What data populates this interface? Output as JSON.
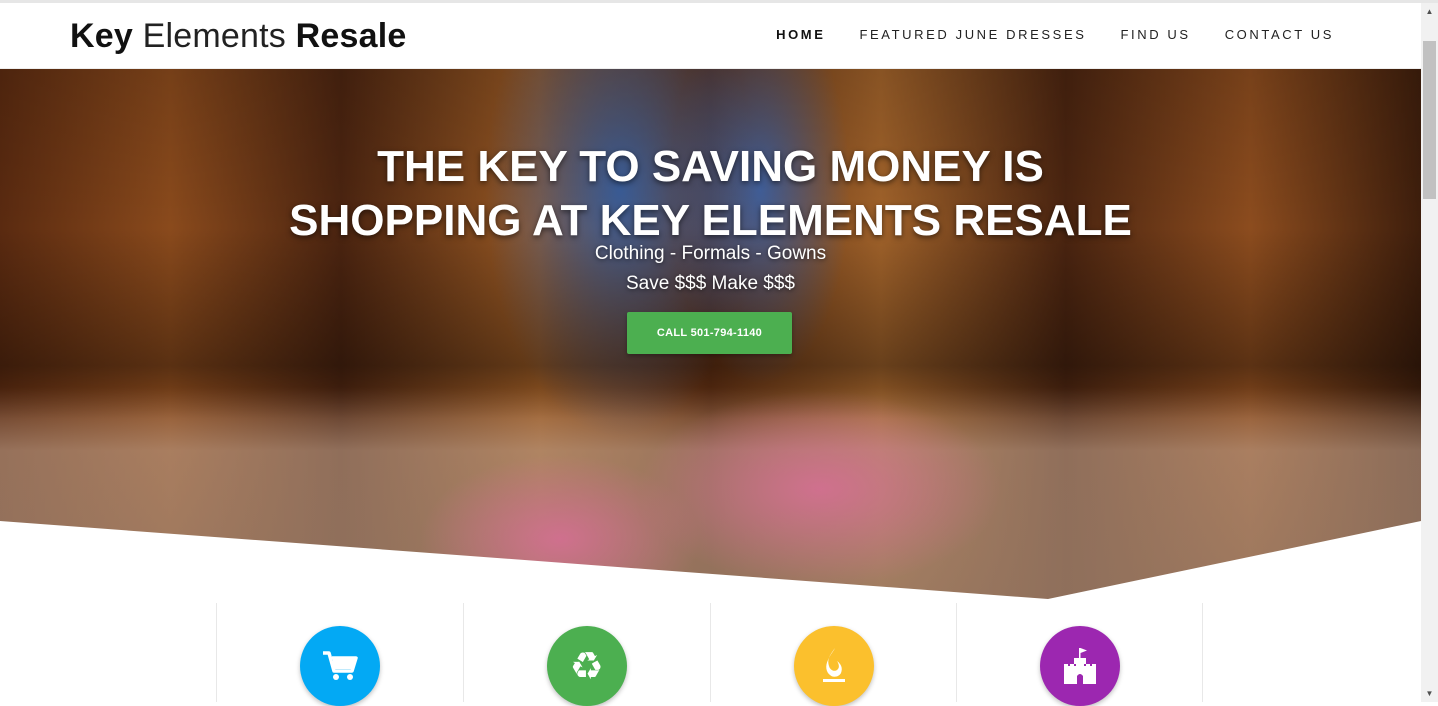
{
  "header": {
    "logo_part1": "Key",
    "logo_part2": "Elements",
    "logo_part3": "Resale"
  },
  "nav": {
    "items": [
      {
        "label": "HOME",
        "active": true
      },
      {
        "label": "FEATURED JUNE DRESSES",
        "active": false
      },
      {
        "label": "FIND US",
        "active": false
      },
      {
        "label": "CONTACT US",
        "active": false
      }
    ]
  },
  "hero": {
    "title": "THE KEY TO SAVING MONEY IS SHOPPING AT KEY ELEMENTS RESALE",
    "subtitle_line1": "Clothing - Formals - Gowns",
    "subtitle_line2": "Save $$$ Make $$$",
    "cta_label": "CALL 501-794-1140"
  },
  "features": [
    {
      "icon": "shopping-cart-icon",
      "color": "#03a9f4"
    },
    {
      "icon": "recycle-icon",
      "color": "#4caf50"
    },
    {
      "icon": "flame-icon",
      "color": "#fbc02d"
    },
    {
      "icon": "castle-icon",
      "color": "#9c27b0"
    }
  ],
  "colors": {
    "accent_green": "#4caf50"
  }
}
